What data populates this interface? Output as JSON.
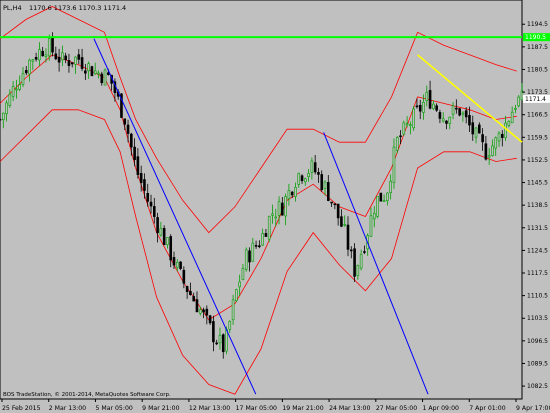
{
  "header": {
    "symbol_timeframe": "PL,H4",
    "ohlc": "1170.6 1173.6 1170.3 1171.4"
  },
  "footer": {
    "copyright": "BOS TradeStation, © 2001-2014, MetaQuotes Software Corp."
  },
  "colors": {
    "background": "#c0c0c0",
    "bull_candle": "#00a000",
    "bear_candle": "#000000",
    "bands": "#ff0000",
    "resistance_line": "#00ff00",
    "trend_line": "#0000ff",
    "channel_line": "#ffff00",
    "price_tag": "#ffffff"
  },
  "chart_data": {
    "type": "candlestick",
    "ylim": [
      1078.5,
      1202
    ],
    "price_axis_ticks": [
      "1194.5",
      "1187.5",
      "1180.5",
      "1173.5",
      "1166.5",
      "1159.5",
      "1152.5",
      "1145.5",
      "1138.5",
      "1131.5",
      "1124.5",
      "1117.5",
      "1110.5",
      "1103.5",
      "1096.5",
      "1089.5",
      "1082.5"
    ],
    "time_axis_labels": [
      "25 Feb 2015",
      "2 Mar 13:00",
      "5 Mar 05:00",
      "9 Mar 21:00",
      "12 Mar 13:00",
      "17 Mar 05:00",
      "19 Mar 21:00",
      "24 Mar 13:00",
      "27 Mar 05:00",
      "1 Apr 09:00",
      "7 Apr 01:00",
      "9 Apr 17:00"
    ],
    "last_price": "1171.4",
    "resistance_level": "1190.5",
    "close_path": [
      [
        0,
        1165
      ],
      [
        3,
        1176
      ],
      [
        6,
        1184
      ],
      [
        9,
        1188
      ],
      [
        12,
        1183
      ],
      [
        15,
        1184
      ],
      [
        18,
        1180
      ],
      [
        21,
        1178
      ],
      [
        24,
        1165
      ],
      [
        26,
        1150
      ],
      [
        29,
        1137
      ],
      [
        32,
        1126
      ],
      [
        35,
        1115
      ],
      [
        38,
        1107
      ],
      [
        41,
        1098
      ],
      [
        43,
        1094
      ],
      [
        45,
        1110
      ],
      [
        47,
        1122
      ],
      [
        50,
        1128
      ],
      [
        52,
        1136
      ],
      [
        54,
        1138
      ],
      [
        57,
        1148
      ],
      [
        60,
        1150
      ],
      [
        63,
        1142
      ],
      [
        66,
        1130
      ],
      [
        68,
        1118
      ],
      [
        70,
        1128
      ],
      [
        72,
        1140
      ],
      [
        74,
        1142
      ],
      [
        76,
        1158
      ],
      [
        79,
        1165
      ],
      [
        82,
        1172
      ],
      [
        85,
        1166
      ],
      [
        88,
        1168
      ],
      [
        91,
        1160
      ],
      [
        93,
        1155
      ],
      [
        95,
        1158
      ],
      [
        97,
        1164
      ],
      [
        99,
        1171
      ]
    ],
    "bands": {
      "upper": [
        [
          0,
          1190
        ],
        [
          5,
          1196
        ],
        [
          10,
          1200
        ],
        [
          15,
          1196
        ],
        [
          20,
          1192
        ],
        [
          23,
          1178
        ],
        [
          26,
          1165
        ],
        [
          30,
          1153
        ],
        [
          35,
          1140
        ],
        [
          40,
          1130
        ],
        [
          45,
          1138
        ],
        [
          50,
          1150
        ],
        [
          55,
          1162
        ],
        [
          60,
          1162
        ],
        [
          65,
          1158
        ],
        [
          70,
          1158
        ],
        [
          75,
          1172
        ],
        [
          80,
          1192
        ],
        [
          85,
          1188
        ],
        [
          90,
          1185
        ],
        [
          95,
          1182
        ],
        [
          99,
          1180
        ]
      ],
      "middle": [
        [
          0,
          1170
        ],
        [
          5,
          1178
        ],
        [
          10,
          1185
        ],
        [
          15,
          1182
        ],
        [
          20,
          1178
        ],
        [
          23,
          1168
        ],
        [
          26,
          1150
        ],
        [
          30,
          1130
        ],
        [
          35,
          1115
        ],
        [
          40,
          1103
        ],
        [
          45,
          1108
        ],
        [
          50,
          1122
        ],
        [
          55,
          1140
        ],
        [
          60,
          1145
        ],
        [
          65,
          1138
        ],
        [
          70,
          1135
        ],
        [
          75,
          1150
        ],
        [
          80,
          1172
        ],
        [
          85,
          1170
        ],
        [
          90,
          1168
        ],
        [
          95,
          1165
        ],
        [
          99,
          1166
        ]
      ],
      "lower": [
        [
          0,
          1152
        ],
        [
          5,
          1160
        ],
        [
          10,
          1168
        ],
        [
          15,
          1168
        ],
        [
          20,
          1165
        ],
        [
          23,
          1155
        ],
        [
          26,
          1135
        ],
        [
          30,
          1110
        ],
        [
          35,
          1092
        ],
        [
          40,
          1083
        ],
        [
          45,
          1080
        ],
        [
          50,
          1094
        ],
        [
          55,
          1118
        ],
        [
          60,
          1130
        ],
        [
          65,
          1120
        ],
        [
          70,
          1112
        ],
        [
          75,
          1122
        ],
        [
          80,
          1150
        ],
        [
          85,
          1155
        ],
        [
          90,
          1155
        ],
        [
          95,
          1152
        ],
        [
          99,
          1153
        ]
      ]
    },
    "trend_lines": [
      {
        "color": "trend_line",
        "x1": 18,
        "y1": 1190,
        "x2": 49,
        "y2": 1080
      },
      {
        "color": "trend_line",
        "x1": 62,
        "y1": 1161,
        "x2": 82,
        "y2": 1080
      },
      {
        "color": "channel_line",
        "x1": 80,
        "y1": 1185,
        "x2": 100,
        "y2": 1158
      }
    ]
  }
}
